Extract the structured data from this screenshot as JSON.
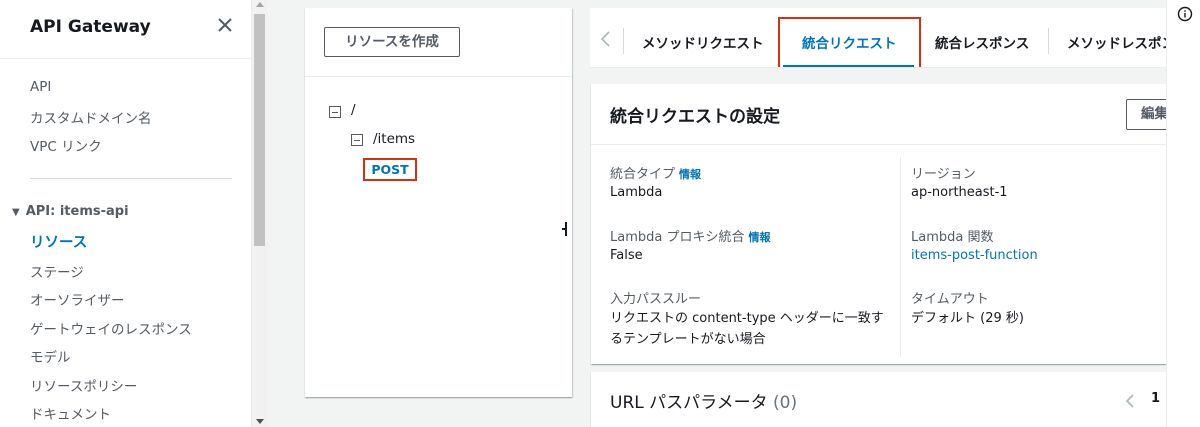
{
  "sidebar": {
    "title": "API Gateway",
    "top_items": [
      {
        "label": "API"
      },
      {
        "label": "カスタムドメイン名"
      },
      {
        "label": "VPC リンク"
      }
    ],
    "section": "API: items-api",
    "api_items": [
      {
        "label": "リソース",
        "active": true
      },
      {
        "label": "ステージ"
      },
      {
        "label": "オーソライザー"
      },
      {
        "label": "ゲートウェイのレスポンス"
      },
      {
        "label": "モデル"
      },
      {
        "label": "リソースポリシー"
      },
      {
        "label": "ドキュメント"
      }
    ]
  },
  "resources": {
    "create_button": "リソースを作成",
    "root": "/",
    "child": "/items",
    "method": "POST"
  },
  "tabs": {
    "items": [
      {
        "label": "メソッドリクエスト"
      },
      {
        "label": "統合リクエスト",
        "active": true
      },
      {
        "label": "統合レスポンス"
      },
      {
        "label": "メソッドレスポンス"
      }
    ]
  },
  "integration": {
    "title": "統合リクエストの設定",
    "edit_button": "編集",
    "info_label": "情報",
    "fields_left": [
      {
        "label": "統合タイプ",
        "info": true,
        "value": "Lambda"
      },
      {
        "label": "Lambda プロキシ統合",
        "info": true,
        "value": "False"
      },
      {
        "label": "入力パススルー",
        "info": false,
        "value_line1": "リクエストの content-type ヘッダーに一致す",
        "value_line2": "るテンプレートがない場合"
      }
    ],
    "fields_right": [
      {
        "label": "リージョン",
        "value": "ap-northeast-1"
      },
      {
        "label": "Lambda 関数",
        "value": "items-post-function",
        "link": true
      },
      {
        "label": "タイムアウト",
        "value": "デフォルト (29 秒)"
      }
    ]
  },
  "url_params": {
    "title": "URL パスパラメータ",
    "count": "(0)",
    "page": "1"
  },
  "colors": {
    "accent": "#0073bb",
    "highlight": "#d13212",
    "text": "#16191f",
    "secondary_text": "#545b64"
  },
  "icons": {
    "close": "close-icon",
    "info": "info-icon",
    "chevron_left": "chevron-left-icon",
    "expand": "collapse-box-icon"
  }
}
